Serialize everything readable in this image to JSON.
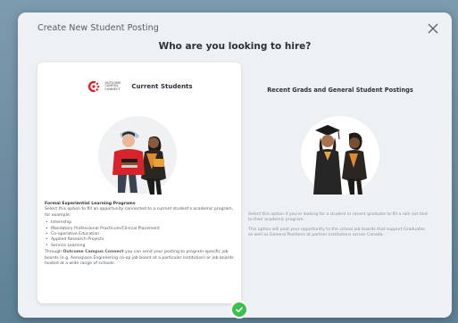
{
  "modal": {
    "title": "Create New Student Posting",
    "question": "Who are you looking to hire?",
    "close_icon": "close-icon"
  },
  "options": [
    {
      "heading": "Current Students",
      "selected": true,
      "logo_text": "Outcome Campus Connect",
      "program_title": "Formal Experiential Learning Programs",
      "intro": "Select this option to fill an opportunity connected to a current student's academic program, for example:",
      "items": [
        "Internship",
        "Mandatory Professional Practicum/Clinical Placement",
        "Co-operative Education",
        "Applied Research Projects",
        "Service Learning"
      ],
      "footer_prefix": "Through ",
      "footer_brand": "Outcome Campus Connect",
      "footer_rest": " you can send your posting to program-specific job boards (e.g. Aerospace Engineering co-op job board at a particular institution) or job boards hosted at a wide range of schools."
    },
    {
      "heading": "Recent Grads and General Student Postings",
      "selected": false,
      "para1": "Select this option if you're looking for a student or recent graduate to fill a role not tied to their academic program.",
      "para2": "This option will post your opportunity to the school job boards that support Graduates as well as General Positions at partner institutions across Canada."
    }
  ],
  "colors": {
    "accent_red": "#d8232a",
    "check_green": "#3cc04b",
    "modal_bg": "#eef1f3"
  },
  "status": {
    "selected_icon": "check-icon"
  }
}
